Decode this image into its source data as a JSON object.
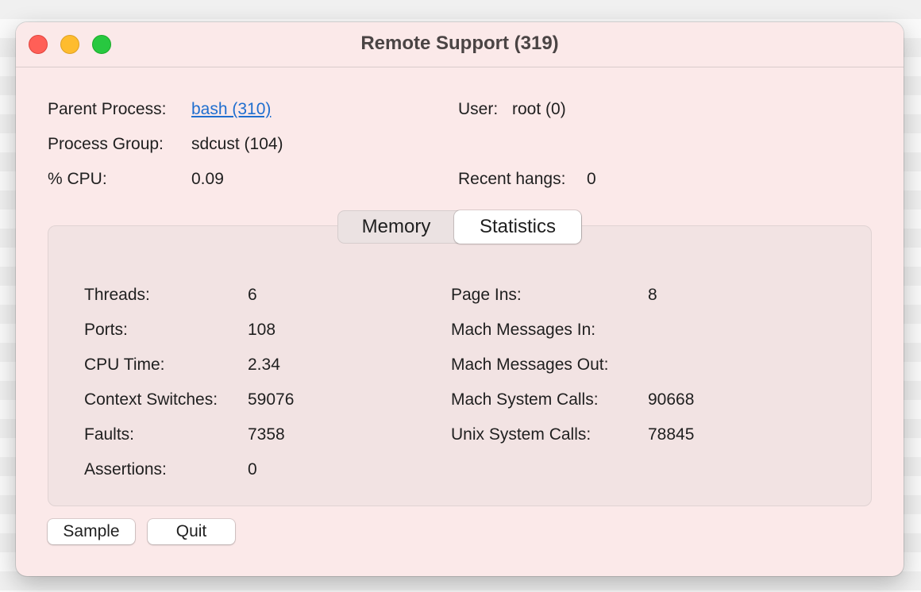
{
  "window": {
    "title": "Remote Support (319)"
  },
  "info": {
    "parent_process_label": "Parent Process:",
    "parent_process_value": "bash (310)",
    "user_label": "User:",
    "user_value": "root (0)",
    "process_group_label": "Process Group:",
    "process_group_value": "sdcust (104)",
    "cpu_label": "% CPU:",
    "cpu_value": "0.09",
    "recent_hangs_label": "Recent hangs:",
    "recent_hangs_value": "0"
  },
  "tabs": [
    {
      "label": "Memory",
      "selected": false
    },
    {
      "label": "Statistics",
      "selected": true
    }
  ],
  "stats_left": [
    {
      "label": "Threads:",
      "value": "6"
    },
    {
      "label": "Ports:",
      "value": "108"
    },
    {
      "label": "CPU Time:",
      "value": "2.34"
    },
    {
      "label": "Context Switches:",
      "value": "59076"
    },
    {
      "label": "Faults:",
      "value": "7358"
    },
    {
      "label": "Assertions:",
      "value": "0"
    }
  ],
  "stats_right": [
    {
      "label": "Page Ins:",
      "value": "8"
    },
    {
      "label": "Mach Messages In:",
      "value": ""
    },
    {
      "label": "Mach Messages Out:",
      "value": ""
    },
    {
      "label": "Mach System Calls:",
      "value": "90668"
    },
    {
      "label": "Unix System Calls:",
      "value": "78845"
    }
  ],
  "buttons": {
    "sample": "Sample",
    "quit": "Quit"
  },
  "colors": {
    "window_bg": "#fbe9e9",
    "link": "#1f6ecf",
    "close": "#ff5f57",
    "minimize": "#febc2e",
    "maximize": "#28c840"
  }
}
